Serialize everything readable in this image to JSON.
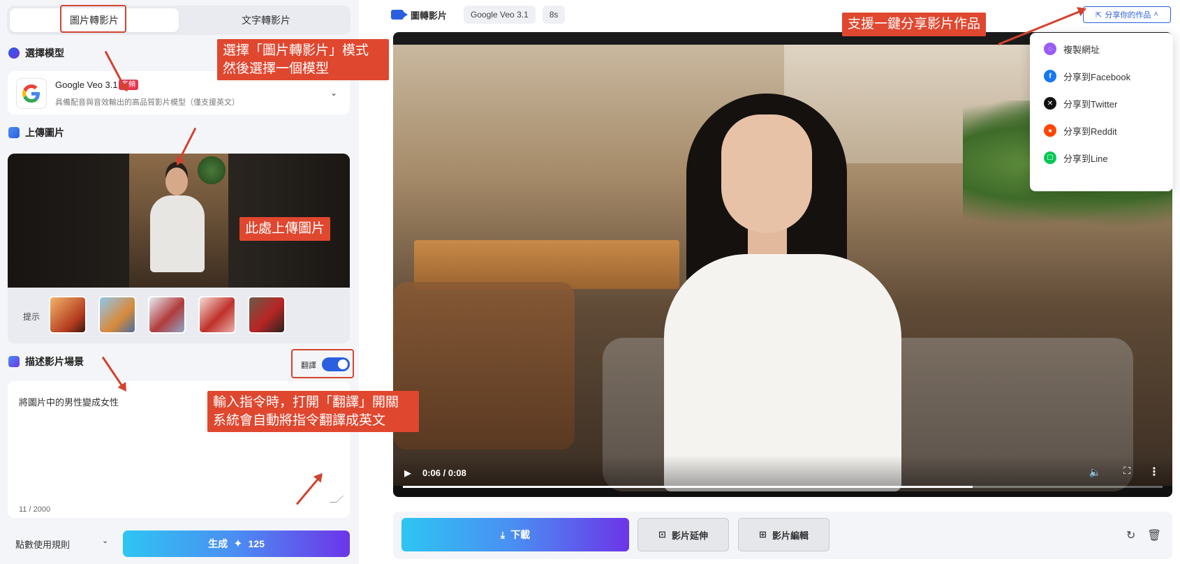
{
  "left": {
    "tabs": [
      {
        "label": "圖片轉影片",
        "active": true
      },
      {
        "label": "文字轉影片",
        "active": false
      }
    ],
    "model_section": {
      "title": "選擇模型",
      "model_name": "Google Veo 3.1",
      "model_badge": "音頻",
      "model_desc": "具備配音與音效輸出的高品質影片模型（僅支援英文）"
    },
    "upload_section": {
      "title": "上傳圖片",
      "tips_label": "提示"
    },
    "prompt_section": {
      "title": "描述影片場景",
      "translate_label": "翻譯",
      "translate_on": true,
      "prompt_value": "將圖片中的男性變成女性",
      "counter": "11 / 2000"
    },
    "footer": {
      "rules_label": "點數使用規則",
      "generate_label": "生成",
      "generate_cost": "125"
    }
  },
  "right": {
    "top_bar": {
      "mode": "圖轉影片",
      "model": "Google Veo 3.1",
      "duration": "8s",
      "share_button": "分享你的作品"
    },
    "video": {
      "time": "0:06 / 0:08",
      "progress": 0.75
    },
    "share_menu": [
      {
        "label": "複製網址",
        "icon": "link-icon",
        "color": "#9b5cf6"
      },
      {
        "label": "分享到Facebook",
        "icon": "facebook-icon",
        "color": "#1877f2"
      },
      {
        "label": "分享到Twitter",
        "icon": "x-twitter-icon",
        "color": "#111111"
      },
      {
        "label": "分享到Reddit",
        "icon": "reddit-icon",
        "color": "#ff4500"
      },
      {
        "label": "分享到Line",
        "icon": "line-icon",
        "color": "#06c755"
      }
    ],
    "actions": {
      "download": "下載",
      "extend": "影片延伸",
      "edit": "影片編輯"
    }
  },
  "annotations": {
    "mode_tip": "選擇「圖片轉影片」模式\n然後選擇一個模型",
    "upload_tip": "此處上傳圖片",
    "translate_tip": "輸入指令時，打開「翻譯」開關\n系統會自動將指令翻譯成英文",
    "share_tip": "支援一鍵分享影片作品"
  },
  "colors": {
    "accent": "#2b5fe0",
    "annotation": "#e0472f",
    "gradient_start": "#2ec5f2",
    "gradient_end": "#6c35e8"
  }
}
